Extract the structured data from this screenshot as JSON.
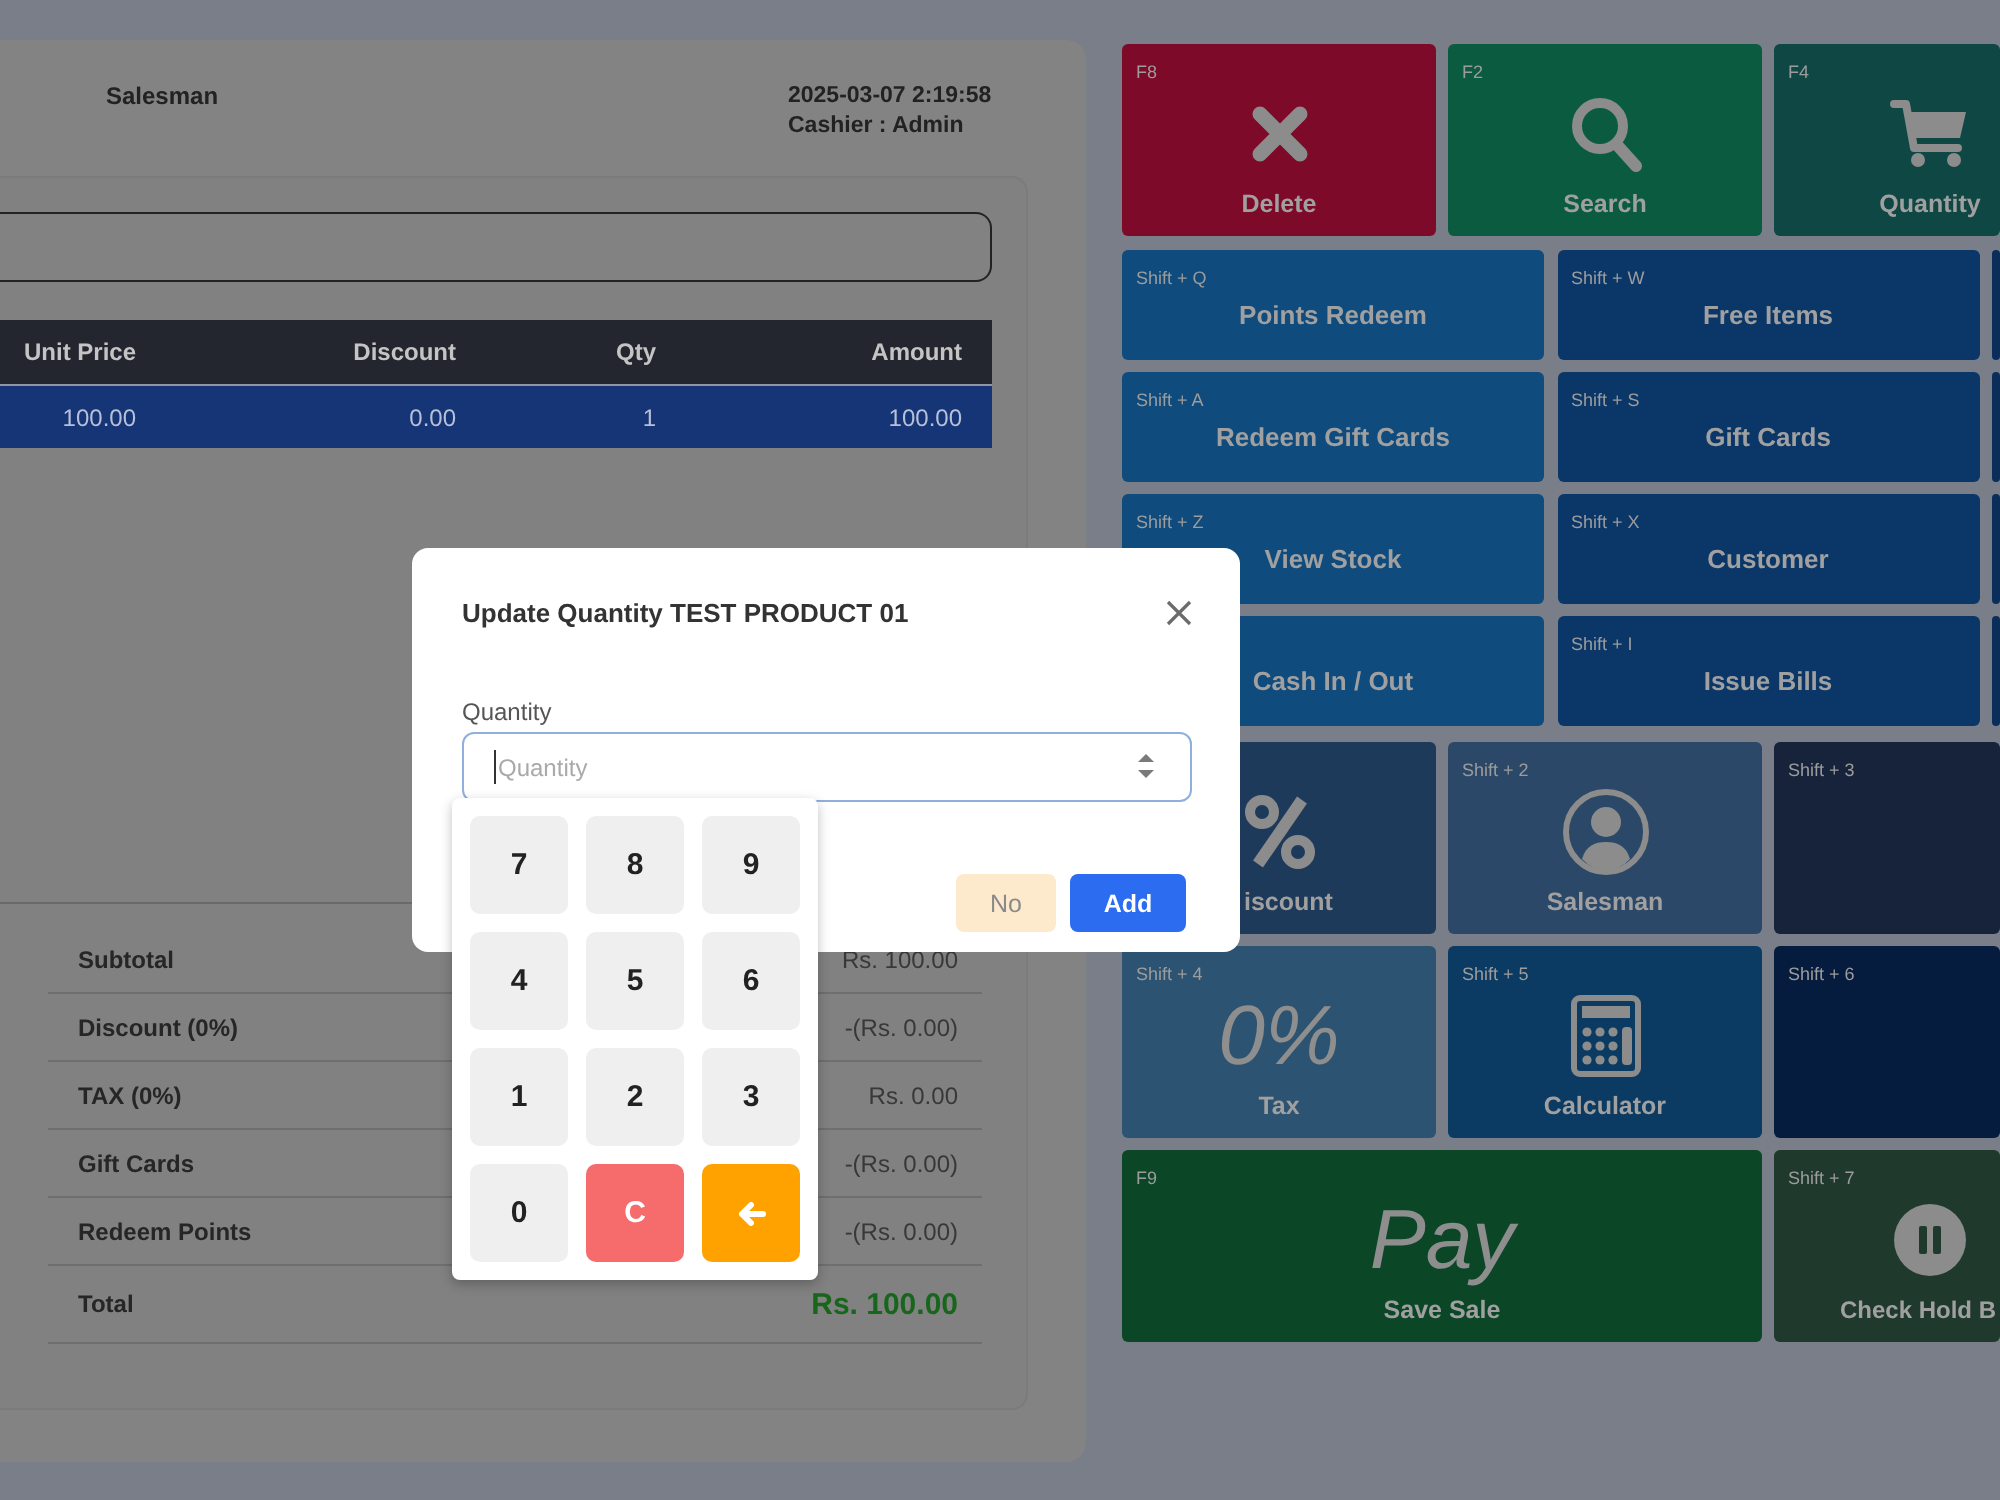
{
  "header": {
    "salesman": "Salesman",
    "datetime": "2025-03-07 2:19:58",
    "cashier": "Cashier : Admin"
  },
  "table": {
    "columns": [
      "Unit Price",
      "Discount",
      "Qty",
      "Amount"
    ],
    "rows": [
      {
        "cells": [
          "100.00",
          "0.00",
          "1",
          "100.00"
        ],
        "selected": true
      }
    ]
  },
  "summary": [
    {
      "label": "Subtotal",
      "value": "Rs. 100.00",
      "kind": "line"
    },
    {
      "label": "Discount (0%)",
      "value": "-(Rs. 0.00)",
      "kind": "line"
    },
    {
      "label": "TAX (0%)",
      "value": "Rs. 0.00",
      "kind": "line"
    },
    {
      "label": "Gift Cards",
      "value": "-(Rs. 0.00)",
      "kind": "line"
    },
    {
      "label": "Redeem Points",
      "value": "-(Rs. 0.00)",
      "kind": "line"
    },
    {
      "label": "Total",
      "value": "Rs. 100.00",
      "kind": "total"
    }
  ],
  "function_keys": [
    {
      "shortcut": "F8",
      "label": "Delete",
      "color": "#7e0a2a"
    },
    {
      "shortcut": "F2",
      "label": "Search",
      "color": "#0b5b41"
    },
    {
      "shortcut": "F4",
      "label": "Quantity",
      "color": "#0f4744"
    }
  ],
  "menu_buttons": [
    {
      "shortcut": "Shift + Q",
      "label": "Points Redeem",
      "color": "#0f4b7d"
    },
    {
      "shortcut": "Shift + W",
      "label": "Free Items",
      "color": "#0a3768"
    },
    {
      "color": "#0a2d5a"
    },
    {
      "shortcut": "Shift + A",
      "label": "Redeem Gift Cards",
      "color": "#0f4b7d"
    },
    {
      "shortcut": "Shift + S",
      "label": "Gift Cards",
      "color": "#0a3768"
    },
    {
      "color": "#0a2d5a"
    },
    {
      "shortcut": "Shift + Z",
      "label": "View Stock",
      "color": "#0f4b7d"
    },
    {
      "shortcut": "Shift + X",
      "label": "Customer",
      "color": "#0a3768"
    },
    {
      "color": "#0a2d5a"
    },
    {
      "label": "Cash In / Out",
      "color": "#0f4b7d"
    },
    {
      "shortcut": "Shift + I",
      "label": "Issue Bills",
      "color": "#0a3768"
    },
    {
      "color": "#0a2d5a"
    }
  ],
  "hotkeys": [
    {
      "label": "iscount",
      "color": "#1e3a5a",
      "kind": "icon"
    },
    {
      "shortcut": "Shift + 2",
      "label": "Salesman",
      "color": "#2b4868",
      "kind": "icon"
    },
    {
      "shortcut": "Shift + 3",
      "color": "#17233a",
      "kind": "blank"
    },
    {
      "shortcut": "Shift + 4",
      "figure": "0%",
      "label": "Tax",
      "color": "#2c5472",
      "kind": "figure"
    },
    {
      "shortcut": "Shift + 5",
      "label": "Calculator",
      "color": "#0b3b62",
      "kind": "icon"
    },
    {
      "shortcut": "Shift + 6",
      "color": "#051c3e",
      "kind": "blank"
    },
    {
      "shortcut": "F9",
      "figure": "Pay",
      "label": "Save Sale",
      "color": "#0b4727",
      "kind": "figure"
    },
    {
      "shortcut": "Shift + 7",
      "label": "Check Hold B",
      "color": "#1f3a2d",
      "kind": "icon"
    }
  ],
  "dialog": {
    "title": "Update Quantity TEST PRODUCT 01",
    "field_label": "Quantity",
    "placeholder": "Quantity",
    "focused": true,
    "buttons": [
      {
        "label": "No",
        "kind": "secondary"
      },
      {
        "label": "Add",
        "kind": "primary"
      }
    ]
  },
  "keypad": [
    {
      "label": "7",
      "kind": "digit"
    },
    {
      "label": "8",
      "kind": "digit"
    },
    {
      "label": "9",
      "kind": "digit"
    },
    {
      "label": "4",
      "kind": "digit"
    },
    {
      "label": "5",
      "kind": "digit"
    },
    {
      "label": "6",
      "kind": "digit"
    },
    {
      "label": "1",
      "kind": "digit"
    },
    {
      "label": "2",
      "kind": "digit"
    },
    {
      "label": "3",
      "kind": "digit"
    },
    {
      "label": "0",
      "kind": "digit"
    },
    {
      "label": "C",
      "kind": "clear"
    },
    {
      "kind": "backspace"
    }
  ]
}
